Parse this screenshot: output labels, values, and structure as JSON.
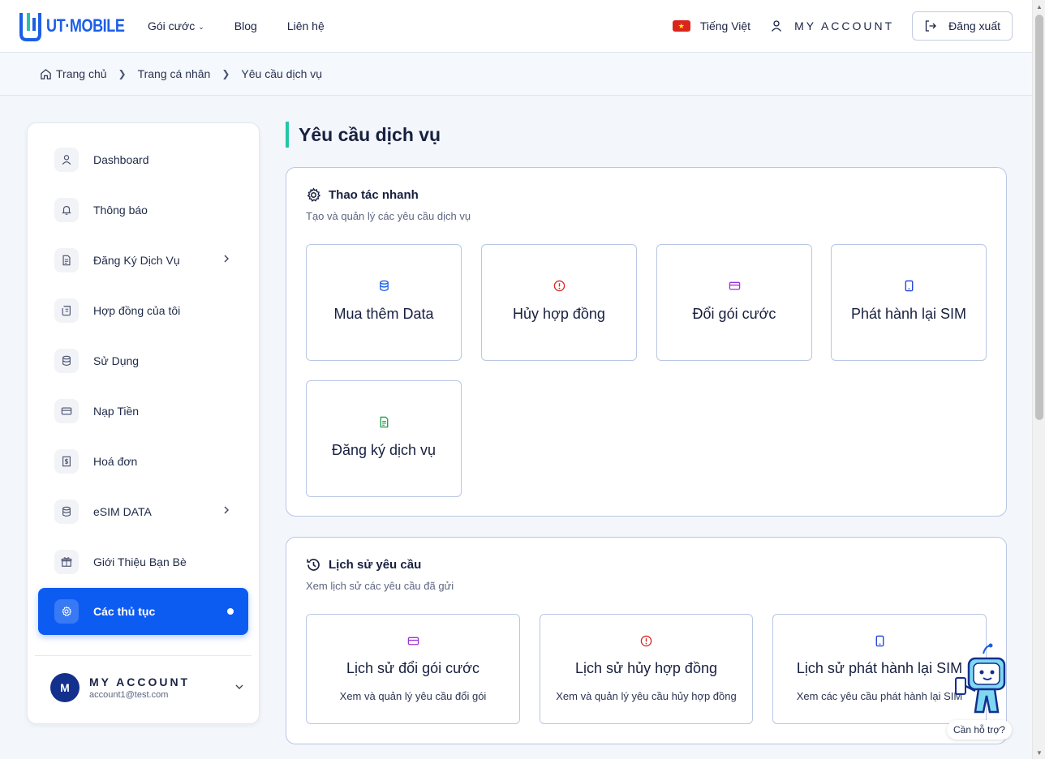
{
  "brand": {
    "logo_text": "UT·MOBILE",
    "accent": "#0d5cf2",
    "teal": "#24c6a4"
  },
  "nav": {
    "items": [
      {
        "label": "Gói cước",
        "has_dropdown": true
      },
      {
        "label": "Blog"
      },
      {
        "label": "Liên hệ"
      }
    ],
    "language": "Tiếng Việt",
    "account": "MY ACCOUNT",
    "logout": "Đăng xuất"
  },
  "breadcrumb": [
    "Trang chủ",
    "Trang cá nhân",
    "Yêu cầu dịch vụ"
  ],
  "sidebar": {
    "items": [
      {
        "label": "Dashboard",
        "icon": "user-icon"
      },
      {
        "label": "Thông báo",
        "icon": "bell-icon"
      },
      {
        "label": "Đăng Ký Dịch Vụ",
        "icon": "document-icon",
        "has_submenu": true
      },
      {
        "label": "Hợp đồng của tôi",
        "icon": "scroll-icon"
      },
      {
        "label": "Sử Dụng",
        "icon": "database-icon"
      },
      {
        "label": "Nạp Tiền",
        "icon": "card-icon"
      },
      {
        "label": "Hoá đơn",
        "icon": "receipt-icon"
      },
      {
        "label": "eSIM DATA",
        "icon": "database-icon",
        "has_submenu": true
      },
      {
        "label": "Giới Thiệu Bạn Bè",
        "icon": "gift-icon"
      },
      {
        "label": "Các thủ tục",
        "icon": "gear-icon",
        "active": true
      }
    ],
    "user": {
      "initial": "M",
      "name": "MY ACCOUNT",
      "email": "account1@test.com"
    }
  },
  "main": {
    "title": "Yêu cầu dịch vụ",
    "quick": {
      "title": "Thao tác nhanh",
      "subtitle": "Tạo và quản lý các yêu cầu dịch vụ",
      "cards": [
        {
          "label": "Mua thêm Data",
          "icon": "database-icon",
          "color": "#1b5ee8"
        },
        {
          "label": "Hủy hợp đồng",
          "icon": "alert-circle-icon",
          "color": "#d92525"
        },
        {
          "label": "Đổi gói cước",
          "icon": "card-icon",
          "color": "#9b30d9"
        },
        {
          "label": "Phát hành lại SIM",
          "icon": "phone-icon",
          "color": "#1b3cd9"
        },
        {
          "label": "Đăng ký dịch vụ",
          "icon": "file-text-icon",
          "color": "#1f9d4a"
        }
      ]
    },
    "history": {
      "title": "Lịch sử yêu cầu",
      "subtitle": "Xem lịch sử các yêu cầu đã gửi",
      "cards": [
        {
          "label": "Lịch sử đổi gói cước",
          "sub": "Xem và quản lý yêu cầu đổi gói",
          "icon": "card-icon",
          "color": "#9b30d9"
        },
        {
          "label": "Lịch sử hủy hợp đồng",
          "sub": "Xem và quản lý yêu cầu hủy hợp đồng",
          "icon": "alert-circle-icon",
          "color": "#d92525"
        },
        {
          "label": "Lịch sử phát hành lại SIM",
          "sub": "Xem các yêu cầu phát hành lại SIM",
          "icon": "phone-icon",
          "color": "#1b3cd9"
        }
      ]
    }
  },
  "support": {
    "label": "Cần hỗ trợ?"
  }
}
